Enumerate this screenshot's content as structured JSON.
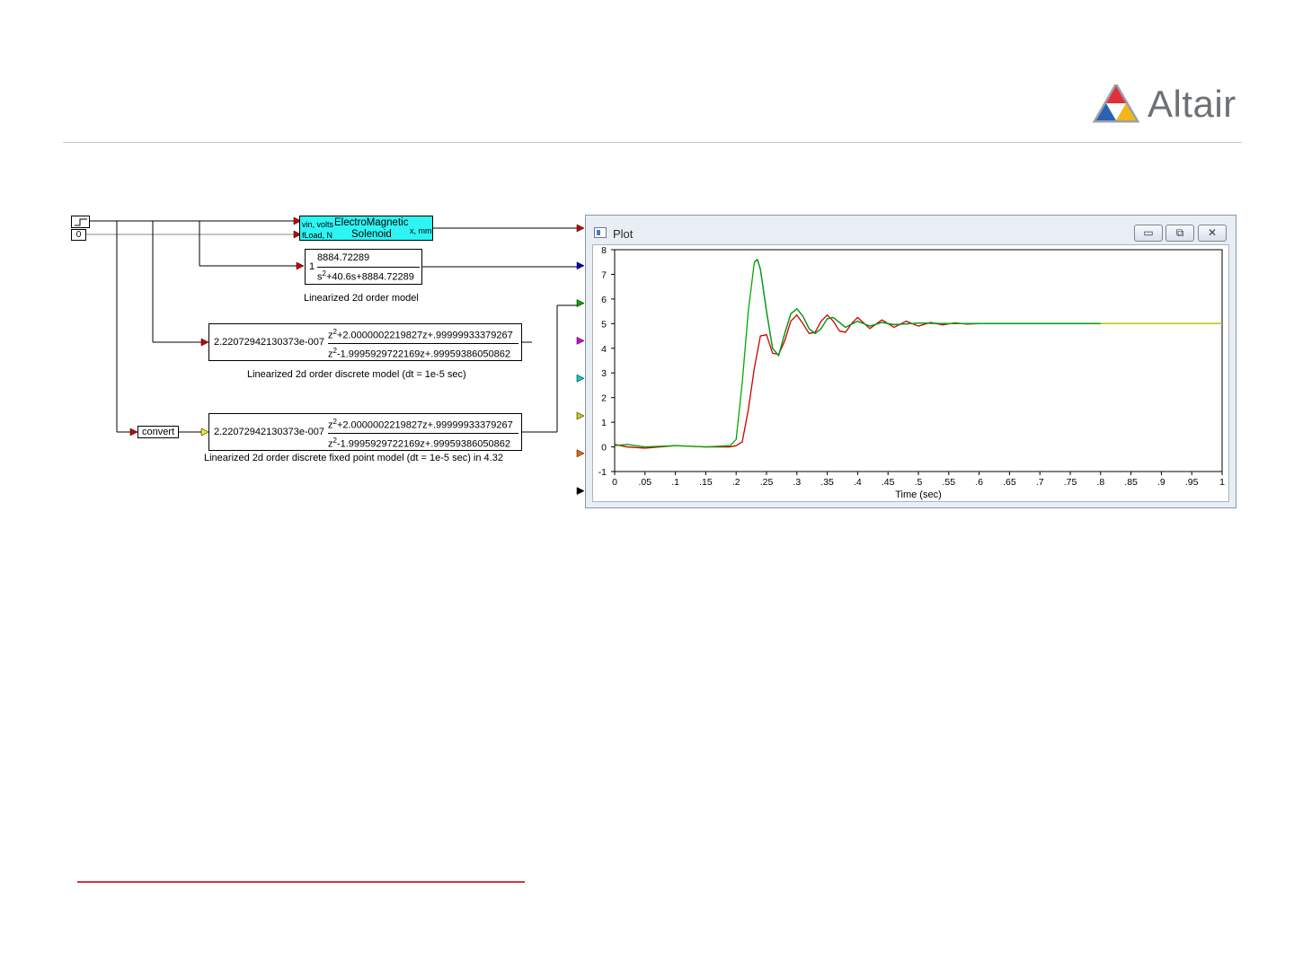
{
  "header": {
    "logo_text": "Altair"
  },
  "diagram": {
    "step_source": {
      "icon": "step-icon"
    },
    "const_source": {
      "value": "0"
    },
    "solenoid": {
      "in1": "vin, volts",
      "in2": "fLoad, N",
      "title": "ElectroMagnetic",
      "subtitle": "Solenoid",
      "out": "x, mm"
    },
    "tf_continuous": {
      "gain": "1",
      "numerator": "8884.72289",
      "den_s": "s",
      "den_exp": "2",
      "den_rest": "+40.6s+8884.72289",
      "caption": "Linearized 2d order model"
    },
    "tf_discrete": {
      "gain": "2.22072942130373e-007",
      "num_z": "z",
      "num_exp": "2",
      "num_rest": "+2.0000002219827z+.99999933379267",
      "den_z": "z",
      "den_exp": "2",
      "den_rest": "-1.9995929722169z+.99959386050862",
      "caption": "Linearized 2d order discrete model (dt = 1e-5 sec)"
    },
    "convert_block": {
      "label": "convert"
    },
    "tf_fixed": {
      "gain": "2.22072942130373e-007",
      "num_z": "z",
      "num_exp": "2",
      "num_rest": "+2.0000002219827z+.99999933379267",
      "den_z": "z",
      "den_exp": "2",
      "den_rest": "-1.9995929722169z+.99959386050862",
      "caption": "Linearized 2d order discrete fixed point model (dt = 1e-5 sec) in 4.32"
    },
    "plot_input_colors": [
      "#cc0000",
      "#0000cc",
      "#00aa00",
      "#dd00dd",
      "#00cccc",
      "#cccc00",
      "#ee6600",
      "#000000"
    ]
  },
  "plot_window": {
    "title": "Plot",
    "minimize_label": "▭",
    "restore_label": "⧉",
    "close_label": "✕"
  },
  "chart_data": {
    "type": "line",
    "xlabel": "Time (sec)",
    "ylabel": "",
    "xlim": [
      0,
      1
    ],
    "ylim": [
      -1,
      8
    ],
    "xticks": [
      "0",
      ".05",
      ".1",
      ".15",
      ".2",
      ".25",
      ".3",
      ".35",
      ".4",
      ".45",
      ".5",
      ".55",
      ".6",
      ".65",
      ".7",
      ".75",
      ".8",
      ".85",
      ".9",
      ".95",
      "1"
    ],
    "yticks": [
      "-1",
      "0",
      "1",
      "2",
      "3",
      "4",
      "5",
      "6",
      "7",
      "8"
    ],
    "grid": false,
    "series": [
      {
        "color": "#cc0000",
        "x": [
          0,
          0.02,
          0.05,
          0.1,
          0.15,
          0.19,
          0.2,
          0.21,
          0.22,
          0.23,
          0.24,
          0.25,
          0.26,
          0.27,
          0.28,
          0.29,
          0.3,
          0.31,
          0.32,
          0.33,
          0.34,
          0.35,
          0.36,
          0.37,
          0.38,
          0.39,
          0.4,
          0.42,
          0.44,
          0.46,
          0.48,
          0.5,
          0.52,
          0.54,
          0.56,
          0.58,
          0.6,
          0.65,
          0.7,
          0.75,
          0.8,
          1.0
        ],
        "y": [
          0.1,
          0.0,
          -0.05,
          0.05,
          0.0,
          0.0,
          0.05,
          0.2,
          1.5,
          3.2,
          4.5,
          4.55,
          3.8,
          3.75,
          4.3,
          5.1,
          5.35,
          5.0,
          4.6,
          4.65,
          5.1,
          5.35,
          5.1,
          4.7,
          4.65,
          5.0,
          5.25,
          4.8,
          5.15,
          4.85,
          5.1,
          4.9,
          5.05,
          4.95,
          5.03,
          4.98,
          5.0,
          5.0,
          5.0,
          5.0,
          5.0,
          5.0
        ]
      },
      {
        "color": "#0000cc",
        "x": [
          0.23,
          0.235,
          0.24,
          0.25,
          0.26,
          0.27,
          0.28,
          0.29,
          0.3,
          0.31,
          0.32,
          0.33,
          0.34,
          0.35,
          0.36,
          0.38,
          0.4,
          0.42,
          0.44,
          0.46,
          0.5,
          0.55,
          0.6,
          0.7,
          0.8,
          1.0
        ],
        "y": [
          7.5,
          7.6,
          7.2,
          5.5,
          4.0,
          3.7,
          4.6,
          5.4,
          5.6,
          5.3,
          4.8,
          4.6,
          4.8,
          5.2,
          5.25,
          4.85,
          5.1,
          4.9,
          5.05,
          4.96,
          5.02,
          5.0,
          5.0,
          5.0,
          5.0,
          5.0
        ]
      },
      {
        "color": "#00aa00",
        "x": [
          0,
          0.02,
          0.05,
          0.1,
          0.15,
          0.19,
          0.2,
          0.21,
          0.22,
          0.23,
          0.235,
          0.24,
          0.25,
          0.26,
          0.27,
          0.28,
          0.29,
          0.3,
          0.31,
          0.32,
          0.33,
          0.34,
          0.35,
          0.36,
          0.38,
          0.4,
          0.42,
          0.44,
          0.46,
          0.5,
          0.55,
          0.6,
          0.7,
          0.8,
          1.0
        ],
        "y": [
          0.05,
          0.1,
          0.0,
          0.05,
          0.0,
          0.05,
          0.3,
          2.6,
          5.5,
          7.5,
          7.6,
          7.2,
          5.5,
          4.0,
          3.7,
          4.6,
          5.4,
          5.6,
          5.3,
          4.8,
          4.6,
          4.8,
          5.2,
          5.25,
          4.85,
          5.1,
          4.9,
          5.05,
          4.96,
          5.02,
          5.0,
          5.0,
          5.0,
          5.0,
          5.0
        ]
      },
      {
        "color": "#cccc00",
        "x": [
          0.8,
          1.0
        ],
        "y": [
          5.0,
          5.0
        ]
      }
    ]
  }
}
